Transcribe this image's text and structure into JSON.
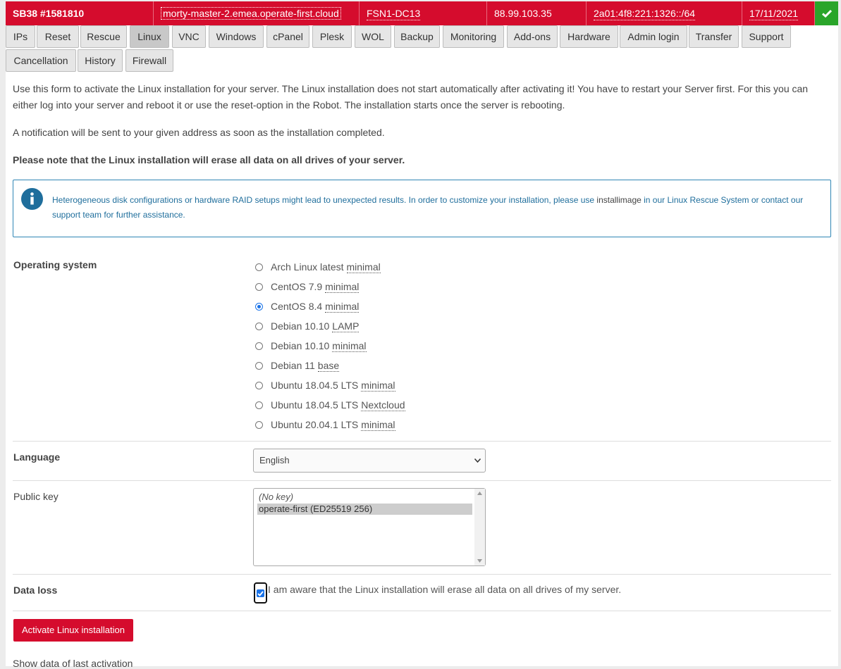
{
  "header": {
    "title": "SB38 #1581810",
    "hostname": "morty-master-2.emea.operate-first.cloud",
    "datacenter": "FSN1-DC13",
    "ipv4": "88.99.103.35",
    "ipv6": "2a01:4f8:221:1326::/64",
    "date": "17/11/2021",
    "status_icon": "check-icon"
  },
  "tabs": [
    {
      "label": "IPs"
    },
    {
      "label": "Reset"
    },
    {
      "label": "Rescue"
    },
    {
      "label": "Linux"
    },
    {
      "label": "VNC"
    },
    {
      "label": "Windows"
    },
    {
      "label": "cPanel"
    },
    {
      "label": "Plesk"
    },
    {
      "label": "WOL"
    },
    {
      "label": "Backup"
    },
    {
      "label": "Monitoring"
    },
    {
      "label": "Add-ons"
    },
    {
      "label": "Hardware"
    },
    {
      "label": "Admin login"
    },
    {
      "label": "Transfer"
    },
    {
      "label": "Support"
    },
    {
      "label": "Cancellation"
    },
    {
      "label": "History"
    },
    {
      "label": "Firewall"
    }
  ],
  "active_tab": "Linux",
  "intro": {
    "line1": "Use this form to activate the Linux installation for your server. The Linux installation does not start automatically after activating it! You have to restart your Server first. For this you can",
    "line2": "either log into your server and reboot it or use the reset-option in the Robot. The installation starts once the server is rebooting.",
    "notification": "A notification will be sent to your given address as soon as the installation completed.",
    "warning": "Please note that the Linux installation will erase all data on all drives of your server."
  },
  "info": {
    "text_before": "Heterogeneous disk configurations or hardware RAID setups might lead to unexpected results. In order to customize your installation, please use ",
    "tool": "installimage",
    "text_after": " in our Linux Rescue System or contact our",
    "line2": "support team for further assistance."
  },
  "form": {
    "os_label": "Operating system",
    "os_options": [
      {
        "name": "Arch Linux latest",
        "variant": "minimal",
        "checked": false
      },
      {
        "name": "CentOS 7.9",
        "variant": "minimal",
        "checked": false
      },
      {
        "name": "CentOS 8.4",
        "variant": "minimal",
        "checked": true
      },
      {
        "name": "Debian 10.10",
        "variant": "LAMP",
        "checked": false
      },
      {
        "name": "Debian 10.10",
        "variant": "minimal",
        "checked": false
      },
      {
        "name": "Debian 11",
        "variant": "base",
        "checked": false
      },
      {
        "name": "Ubuntu 18.04.5 LTS",
        "variant": "minimal",
        "checked": false
      },
      {
        "name": "Ubuntu 18.04.5 LTS",
        "variant": "Nextcloud",
        "checked": false
      },
      {
        "name": "Ubuntu 20.04.1 LTS",
        "variant": "minimal",
        "checked": false
      }
    ],
    "language_label": "Language",
    "language_value": "English",
    "pubkey_label": "Public key",
    "pubkey_options": [
      "(No key)",
      "operate-first (ED25519 256)"
    ],
    "pubkey_selected": 1,
    "dataloss_label": "Data loss",
    "dataloss_text": "I am aware that the Linux installation will erase all data on all drives of my server.",
    "dataloss_checked": true,
    "submit_label": "Activate Linux installation"
  },
  "footer_link": "Show data of last activation",
  "colors": {
    "brand": "#d50c2d",
    "ok": "#2aa52a",
    "info": "#2f86b5"
  }
}
